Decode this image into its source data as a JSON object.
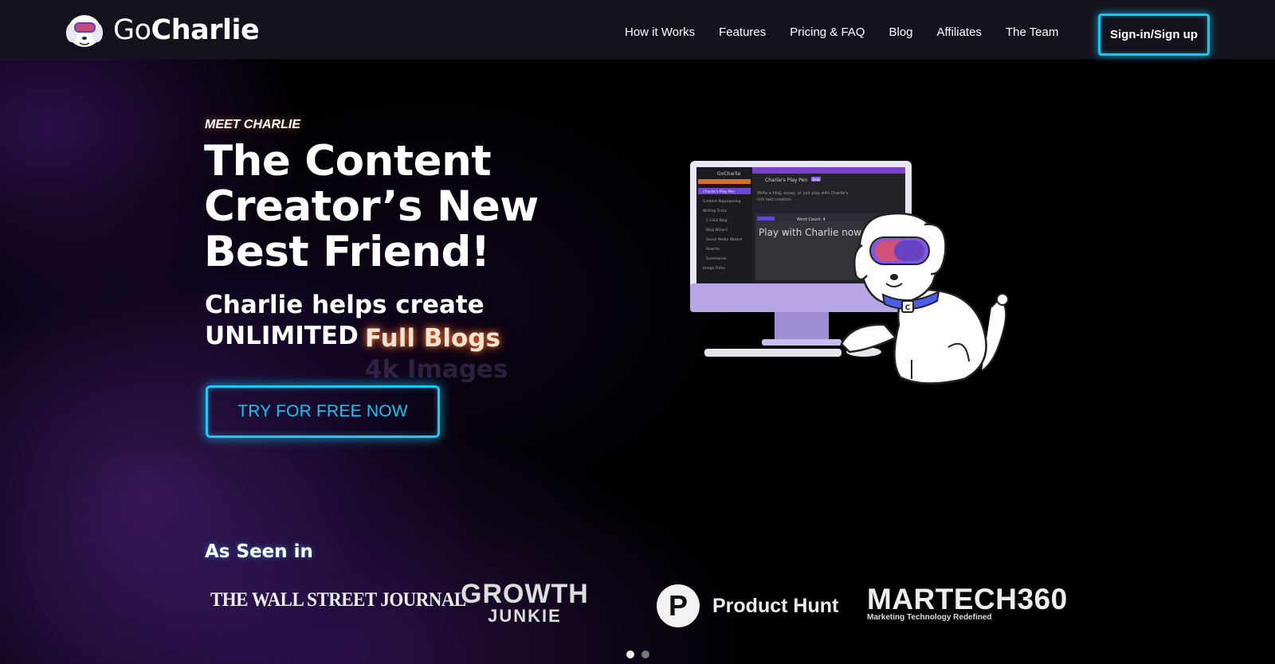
{
  "brand": {
    "logo_go": "Go",
    "logo_charlie": "Charlie",
    "icon": "dog-mascot-icon"
  },
  "nav": {
    "items": [
      "How it Works",
      "Features",
      "Pricing & FAQ",
      "Blog",
      "Affiliates",
      "The Team"
    ],
    "signin_label": "Sign-in/Sign up"
  },
  "hero": {
    "eyebrow": "MEET CHARLIE",
    "headline_lines": [
      "The Content",
      "Creator’s New",
      "Best Friend!"
    ],
    "sub_line1": "Charlie helps create",
    "sub_line2": "UNLIMITED",
    "rotating_words": [
      "Full Blogs",
      "4k Images"
    ],
    "cta_label": "TRY FOR FREE NOW"
  },
  "mockup_screen": {
    "app_title": "GoCharlie",
    "panel_title": "Charlie's Play Pen",
    "panel_badge": "Beta",
    "panel_desc_1": "Write a blog, essay, or just play with Charlie's",
    "panel_desc_2": "rich text creation.",
    "word_count": "Word Count: 4",
    "editor_text": "Play with Charlie now!",
    "sidebar_items": [
      "Charlie's Play Pen",
      "Content Repurposing",
      "Writing Tricks",
      "1-Click Blog",
      "Blog Wizard",
      "Social Media Wizard",
      "Rewrite",
      "Summarize",
      "Image Tricks"
    ]
  },
  "press": {
    "title": "As Seen in",
    "wsj": "THE WALL STREET JOURNAL",
    "growth_line1": "GROWTH",
    "growth_line2": "JUNKIE",
    "ph_letter": "P",
    "ph_name": "Product Hunt",
    "martech_main": "MARTECH360",
    "martech_sub": "Marketing Technology Redefined"
  },
  "carousel": {
    "active_index": 0,
    "count": 2
  },
  "colors": {
    "accent_cyan": "#14c8f5",
    "header_bg": "#14131d",
    "glow_orange": "#ff7a28"
  }
}
